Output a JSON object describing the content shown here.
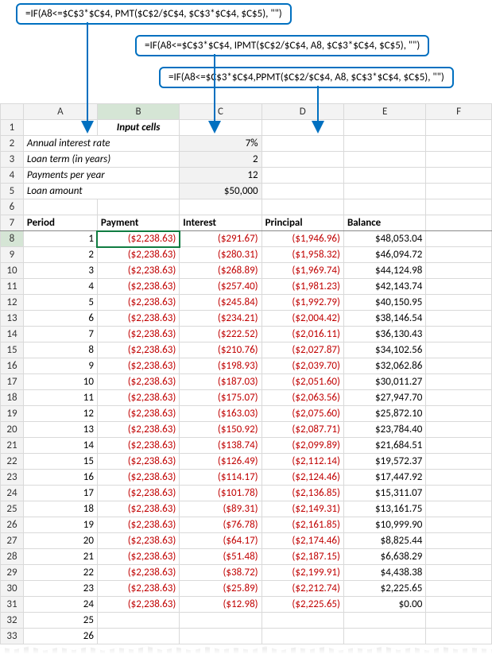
{
  "callouts": {
    "c1": "=IF(A8<=$C$3*$C$4, PMT($C$2/$C$4, $C$3*$C$4, $C$5), \"\")",
    "c2": "=IF(A8<=$C$3*$C$4, IPMT($C$2/$C$4, A8, $C$3*$C$4, $C$5), \"\")",
    "c3": "=IF(A8<=$C$3*$C$4,PPMT($C$2/$C$4, A8, $C$3*$C$4, $C$5), \"\")"
  },
  "columns": [
    "A",
    "B",
    "C",
    "D",
    "E",
    "F"
  ],
  "input_header": "Input cells",
  "inputs": {
    "r2_label": "Annual interest rate",
    "r2_val": "7%",
    "r3_label": "Loan term (in years)",
    "r3_val": "2",
    "r4_label": "Payments per year",
    "r4_val": "12",
    "r5_label": "Loan amount",
    "r5_val": "$50,000"
  },
  "headers": {
    "period": "Period",
    "payment": "Payment",
    "interest": "Interest",
    "principal": "Principal",
    "balance": "Balance"
  },
  "chart_data": {
    "type": "table",
    "title": "Loan amortization schedule",
    "columns": [
      "Period",
      "Payment",
      "Interest",
      "Principal",
      "Balance"
    ],
    "rows": [
      {
        "row": 8,
        "period": "1",
        "payment": "($2,238.63)",
        "interest": "($291.67)",
        "principal": "($1,946.96)",
        "balance": "$48,053.04"
      },
      {
        "row": 9,
        "period": "2",
        "payment": "($2,238.63)",
        "interest": "($280.31)",
        "principal": "($1,958.32)",
        "balance": "$46,094.72"
      },
      {
        "row": 10,
        "period": "3",
        "payment": "($2,238.63)",
        "interest": "($268.89)",
        "principal": "($1,969.74)",
        "balance": "$44,124.98"
      },
      {
        "row": 11,
        "period": "4",
        "payment": "($2,238.63)",
        "interest": "($257.40)",
        "principal": "($1,981.23)",
        "balance": "$42,143.74"
      },
      {
        "row": 12,
        "period": "5",
        "payment": "($2,238.63)",
        "interest": "($245.84)",
        "principal": "($1,992.79)",
        "balance": "$40,150.95"
      },
      {
        "row": 13,
        "period": "6",
        "payment": "($2,238.63)",
        "interest": "($234.21)",
        "principal": "($2,004.42)",
        "balance": "$38,146.54"
      },
      {
        "row": 14,
        "period": "7",
        "payment": "($2,238.63)",
        "interest": "($222.52)",
        "principal": "($2,016.11)",
        "balance": "$36,130.43"
      },
      {
        "row": 15,
        "period": "8",
        "payment": "($2,238.63)",
        "interest": "($210.76)",
        "principal": "($2,027.87)",
        "balance": "$34,102.56"
      },
      {
        "row": 16,
        "period": "9",
        "payment": "($2,238.63)",
        "interest": "($198.93)",
        "principal": "($2,039.70)",
        "balance": "$32,062.86"
      },
      {
        "row": 17,
        "period": "10",
        "payment": "($2,238.63)",
        "interest": "($187.03)",
        "principal": "($2,051.60)",
        "balance": "$30,011.27"
      },
      {
        "row": 18,
        "period": "11",
        "payment": "($2,238.63)",
        "interest": "($175.07)",
        "principal": "($2,063.56)",
        "balance": "$27,947.70"
      },
      {
        "row": 19,
        "period": "12",
        "payment": "($2,238.63)",
        "interest": "($163.03)",
        "principal": "($2,075.60)",
        "balance": "$25,872.10"
      },
      {
        "row": 20,
        "period": "13",
        "payment": "($2,238.63)",
        "interest": "($150.92)",
        "principal": "($2,087.71)",
        "balance": "$23,784.40"
      },
      {
        "row": 21,
        "period": "14",
        "payment": "($2,238.63)",
        "interest": "($138.74)",
        "principal": "($2,099.89)",
        "balance": "$21,684.51"
      },
      {
        "row": 22,
        "period": "15",
        "payment": "($2,238.63)",
        "interest": "($126.49)",
        "principal": "($2,112.14)",
        "balance": "$19,572.37"
      },
      {
        "row": 23,
        "period": "16",
        "payment": "($2,238.63)",
        "interest": "($114.17)",
        "principal": "($2,124.46)",
        "balance": "$17,447.92"
      },
      {
        "row": 24,
        "period": "17",
        "payment": "($2,238.63)",
        "interest": "($101.78)",
        "principal": "($2,136.85)",
        "balance": "$15,311.07"
      },
      {
        "row": 25,
        "period": "18",
        "payment": "($2,238.63)",
        "interest": "($89.31)",
        "principal": "($2,149.31)",
        "balance": "$13,161.75"
      },
      {
        "row": 26,
        "period": "19",
        "payment": "($2,238.63)",
        "interest": "($76.78)",
        "principal": "($2,161.85)",
        "balance": "$10,999.90"
      },
      {
        "row": 27,
        "period": "20",
        "payment": "($2,238.63)",
        "interest": "($64.17)",
        "principal": "($2,174.46)",
        "balance": "$8,825.44"
      },
      {
        "row": 28,
        "period": "21",
        "payment": "($2,238.63)",
        "interest": "($51.48)",
        "principal": "($2,187.15)",
        "balance": "$6,638.29"
      },
      {
        "row": 29,
        "period": "22",
        "payment": "($2,238.63)",
        "interest": "($38.72)",
        "principal": "($2,199.91)",
        "balance": "$4,438.38"
      },
      {
        "row": 30,
        "period": "23",
        "payment": "($2,238.63)",
        "interest": "($25.89)",
        "principal": "($2,212.74)",
        "balance": "$2,225.65"
      },
      {
        "row": 31,
        "period": "24",
        "payment": "($2,238.63)",
        "interest": "($12.98)",
        "principal": "($2,225.65)",
        "balance": "$0.00"
      },
      {
        "row": 32,
        "period": "25",
        "payment": "",
        "interest": "",
        "principal": "",
        "balance": ""
      },
      {
        "row": 33,
        "period": "26",
        "payment": "",
        "interest": "",
        "principal": "",
        "balance": ""
      }
    ]
  }
}
